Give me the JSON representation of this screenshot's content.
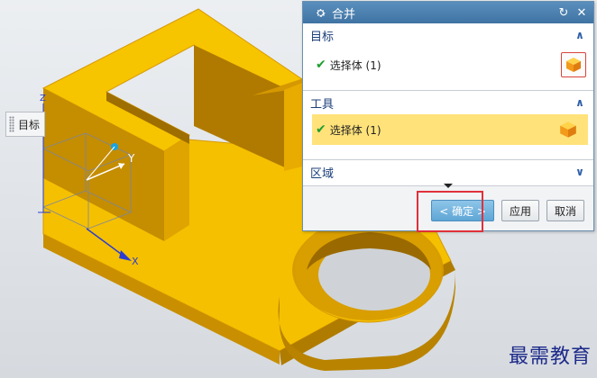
{
  "dialog": {
    "title": "合并",
    "icons": {
      "gear": "gear-icon",
      "reset": "reset-icon",
      "close": "close-icon"
    },
    "sections": {
      "target": {
        "label": "目标",
        "item_label": "选择体 (1)"
      },
      "tool": {
        "label": "工具",
        "item_label": "选择体 (1)"
      },
      "region": {
        "label": "区域"
      }
    },
    "buttons": {
      "ok": "< 确定 >",
      "apply": "应用",
      "cancel": "取消"
    }
  },
  "viewport": {
    "side_label": "目标",
    "axis_y": "Y",
    "axis_x": "X",
    "axis_z": "Z"
  },
  "watermark": "最需教育",
  "colors": {
    "part": "#f5c000",
    "part_side": "#c08a00",
    "titlebar": "#4a7fae",
    "tool_highlight": "#ffe27a",
    "ok_highlight": "#e0303a"
  }
}
